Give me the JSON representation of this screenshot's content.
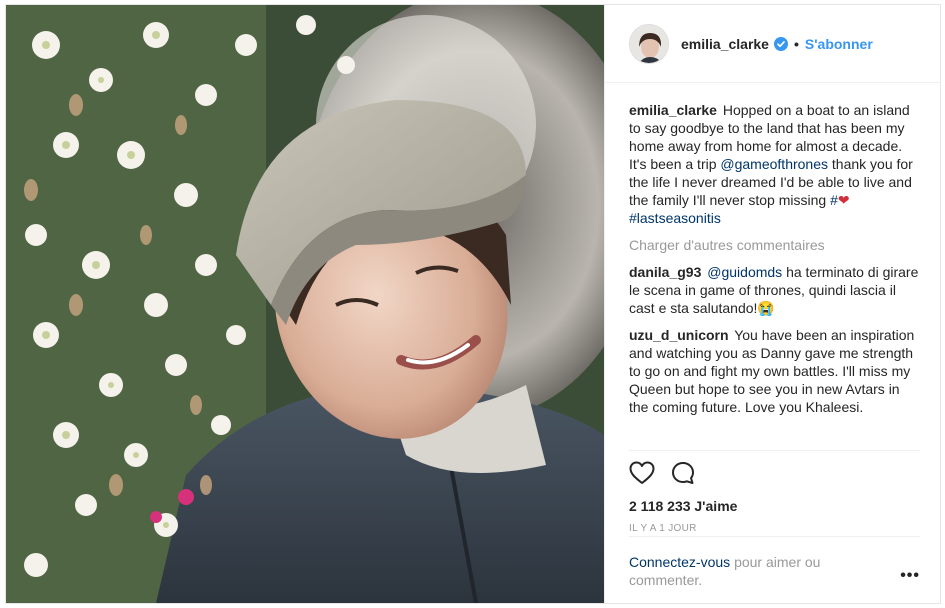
{
  "post": {
    "username": "emilia_clarke",
    "follow_label": "S'abonner",
    "dot": "•",
    "caption": {
      "author": "emilia_clarke",
      "text_part1": "Hopped on a boat to an island to say goodbye to the land that has been my home away from home for almost a decade.",
      "text_part2": "It's been a trip",
      "mention": "@gameofthrones",
      "text_part3": "thank you for the life I never dreamed I'd be able to live and the family I'll never stop missing",
      "hash_symbol": "#",
      "heart": "❤",
      "hashtag": "#lastseasonitis"
    },
    "load_more_label": "Charger d'autres commentaires",
    "comments": [
      {
        "author": "danila_g93",
        "mention": "@guidomds",
        "text": "ha terminato di girare le scena in game of thrones, quindi lascia il cast e sta salutando!😭"
      },
      {
        "author": "uzu_d_unicorn",
        "text": "You have been an inspiration and watching you as Danny gave me strength to go on and fight my own battles. I'll miss my Queen but hope to see you in new Avtars in the coming future. Love you Khaleesi."
      }
    ],
    "likes": "2 118 233 J'aime",
    "time": "IL Y A 1 JOUR",
    "login_link": "Connectez-vous",
    "login_text": "pour aimer ou commenter.",
    "more_label": "•••"
  },
  "colors": {
    "accent": "#3897f0",
    "link": "#003569",
    "muted": "#999999",
    "text": "#262626",
    "border": "#efefef"
  },
  "icons": [
    "verified-badge-icon",
    "heart-outline-icon",
    "comment-bubble-icon",
    "more-options-icon"
  ]
}
